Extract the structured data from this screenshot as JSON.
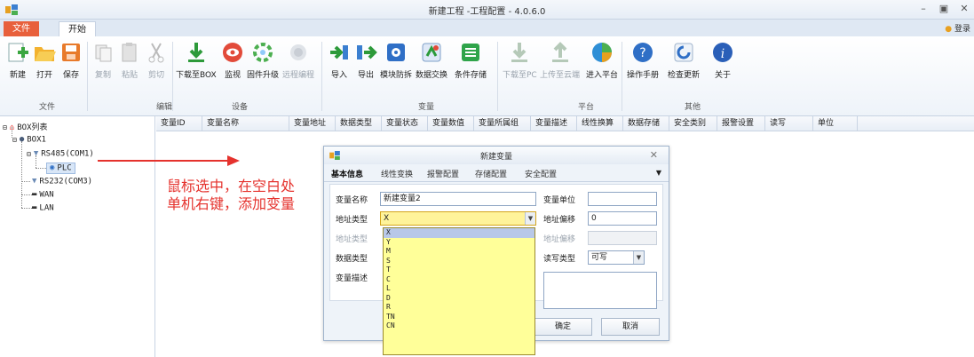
{
  "window": {
    "title": "新建工程 -工程配置 - 4.0.6.0",
    "minimize_icon": "minimize-icon",
    "maximize_icon": "maximize-icon",
    "close_icon": "close-icon"
  },
  "menu_tabs": [
    {
      "label": "文件",
      "active": false
    },
    {
      "label": "开始",
      "active": true
    }
  ],
  "login": {
    "label": "登录"
  },
  "ribbon": {
    "groups": [
      {
        "label": "文件",
        "buttons": [
          {
            "label": "新建",
            "icon": "new-file-icon"
          },
          {
            "label": "打开",
            "icon": "open-folder-icon"
          },
          {
            "label": "保存",
            "icon": "save-icon"
          }
        ]
      },
      {
        "label": "编辑",
        "buttons": [
          {
            "label": "复制",
            "icon": "copy-icon",
            "disabled": true
          },
          {
            "label": "粘贴",
            "icon": "paste-icon",
            "disabled": true
          },
          {
            "label": "剪切",
            "icon": "cut-icon",
            "disabled": true
          }
        ]
      },
      {
        "label": "设备",
        "buttons": [
          {
            "label": "下载至BOX",
            "icon": "download-icon"
          },
          {
            "label": "监视",
            "icon": "monitor-icon"
          },
          {
            "label": "固件升级",
            "icon": "firmware-upgrade-icon"
          },
          {
            "label": "远程编程",
            "icon": "remote-programming-icon",
            "disabled": true
          }
        ]
      },
      {
        "label": "变量",
        "buttons": [
          {
            "label": "导入",
            "icon": "import-icon"
          },
          {
            "label": "导出",
            "icon": "export-icon"
          },
          {
            "label": "模块防拆",
            "icon": "tamper-icon"
          },
          {
            "label": "数据交换",
            "icon": "data-exchange-icon"
          },
          {
            "label": "条件存储",
            "icon": "conditional-storage-icon"
          }
        ]
      },
      {
        "label": "平台",
        "buttons": [
          {
            "label": "下载至PC",
            "icon": "download-pc-icon",
            "disabled": true
          },
          {
            "label": "上传至云端",
            "icon": "upload-cloud-icon",
            "disabled": true
          },
          {
            "label": "进入平台",
            "icon": "platform-icon"
          }
        ]
      },
      {
        "label": "其他",
        "buttons": [
          {
            "label": "操作手册",
            "icon": "help-icon"
          },
          {
            "label": "检查更新",
            "icon": "refresh-icon"
          },
          {
            "label": "关于",
            "icon": "info-icon"
          }
        ]
      }
    ]
  },
  "tree": {
    "root": "BOX列表",
    "box": "BOX1",
    "rs485": "RS485(COM1)",
    "plc": "PLC",
    "rs232": "RS232(COM3)",
    "wan": "WAN",
    "lan": "LAN"
  },
  "grid": {
    "columns": [
      "变量ID",
      "变量名称",
      "变量地址",
      "数据类型",
      "变量状态",
      "变量数值",
      "变量所属组",
      "变量描述",
      "线性换算",
      "数据存储",
      "安全类别",
      "报警设置",
      "读写",
      "单位"
    ]
  },
  "annotation": {
    "line1": "鼠标选中，在空白处",
    "line2": "单机右键，添加变量",
    "color": "#e5322d"
  },
  "dialog": {
    "title": "新建变量",
    "tabs": [
      "基本信息",
      "线性变换",
      "报警配置",
      "存储配置",
      "安全配置"
    ],
    "fields": {
      "name_label": "变量名称",
      "name_value": "新建变量2",
      "unit_label": "变量单位",
      "unit_value": "",
      "addr_type_label": "地址类型",
      "addr_type_value": "X",
      "addr_offset_label": "地址偏移",
      "addr_offset_value": "0",
      "addr_type2_label": "地址类型",
      "addr_offset2_label": "地址偏移",
      "data_type_label": "数据类型",
      "rw_label": "读写类型",
      "rw_value": "可写",
      "desc_label": "变量描述"
    },
    "address_options": [
      "X",
      "Y",
      "M",
      "S",
      "T",
      "C",
      "L",
      "D",
      "R",
      "TN",
      "CN"
    ],
    "selected_option": "X",
    "ok_label": "确定",
    "cancel_label": "取消"
  }
}
